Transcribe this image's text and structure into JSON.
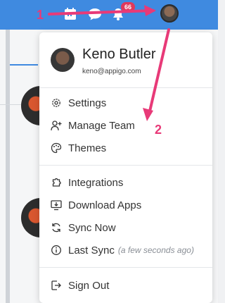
{
  "topbar": {
    "background": "#3f8ae0",
    "icons": [
      "calendar-icon",
      "chat-icon",
      "bell-icon"
    ],
    "notification_count": "66"
  },
  "profile": {
    "name": "Keno Butler",
    "email": "keno@appigo.com"
  },
  "menu": {
    "settings": "Settings",
    "manage_team": "Manage Team",
    "themes": "Themes",
    "integrations": "Integrations",
    "download_apps": "Download Apps",
    "sync_now": "Sync Now",
    "last_sync": "Last Sync",
    "last_sync_time": "(a few seconds ago)",
    "sign_out": "Sign Out"
  },
  "annotations": {
    "step1": "1",
    "step2": "2",
    "color": "#e83a78"
  }
}
